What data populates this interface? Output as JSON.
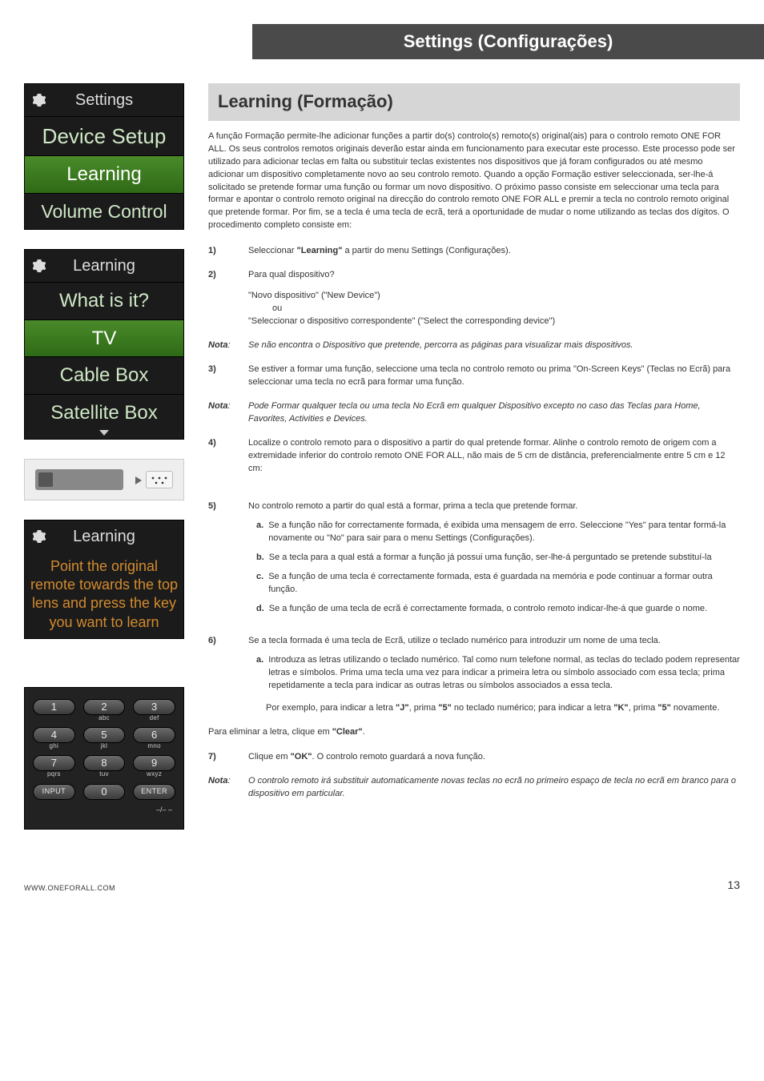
{
  "header": {
    "main_title": "Settings (Configurações)"
  },
  "left": {
    "panel1": {
      "gear": "gear",
      "title": "Settings",
      "rows": [
        "Device Setup",
        "Learning",
        "Volume Control"
      ]
    },
    "panel2": {
      "title": "Learning",
      "rows": [
        "What is it?",
        "TV",
        "Cable Box",
        "Satellite Box"
      ]
    },
    "panel3": {
      "title": "Learning",
      "instruction": "Point the original remote towards the top lens and press the key you want to learn"
    },
    "keypad": {
      "k1": "1",
      "k2": "2",
      "k3": "3",
      "l2": "abc",
      "l3": "def",
      "k4": "4",
      "k5": "5",
      "k6": "6",
      "l4": "ghi",
      "l5": "jkl",
      "l6": "mno",
      "k7": "7",
      "k8": "8",
      "k9": "9",
      "l7": "pqrs",
      "l8": "tuv",
      "l9": "wxyz",
      "kinput": "INPUT",
      "k0": "0",
      "kenter": "ENTER",
      "footnote": "–/– –"
    }
  },
  "right": {
    "section_title": "Learning (Formação)",
    "intro": "A função Formação permite-lhe adicionar funções a partir do(s) controlo(s) remoto(s) original(ais) para o controlo remoto ONE FOR ALL. Os seus controlos remotos originais deverão estar ainda em funcionamento para executar este processo. Este processo pode ser utilizado para adicionar teclas em falta ou substituir teclas existentes nos dispositivos que já foram configurados ou até mesmo adicionar um dispositivo completamente novo ao seu controlo remoto. Quando a opção Formação estiver seleccionada, ser-lhe-á solicitado se pretende formar uma função ou formar um novo dispositivo. O próximo passo consiste em seleccionar uma tecla para formar e apontar o controlo remoto original na direcção do controlo remoto ONE FOR ALL e premir a tecla no controlo remoto original que pretende formar. Por fim, se a tecla é uma tecla de ecrã, terá a oportunidade de mudar o nome utilizando as teclas dos dígitos. O procedimento completo consiste em:",
    "steps": {
      "s1_num": "1)",
      "s1_a": "Seleccionar ",
      "s1_b": "\"Learning\"",
      "s1_c": " a partir do menu Settings (Configurações).",
      "s2_num": "2)",
      "s2_a": "Para qual dispositivo?",
      "s2_b1": "\"Novo dispositivo\" (\"New Device\")",
      "s2_b2": "ou",
      "s2_b3": "\"Seleccionar o dispositivo correspondente\" (\"Select the corresponding device\")",
      "n1_num": "Nota",
      "n1_colon": ":",
      "n1_body": "Se não encontra o Dispositivo que pretende, percorra as páginas para visualizar mais dispositivos.",
      "s3_num": "3)",
      "s3_body": "Se estiver a formar uma função, seleccione uma tecla no controlo remoto ou prima \"On-Screen Keys\" (Teclas no Ecrã) para seleccionar uma tecla no ecrã para formar uma função.",
      "n2_num": "Nota",
      "n2_body": "Pode Formar qualquer tecla ou uma tecla No Ecrã em qualquer Dispositivo excepto no caso das Teclas para Home, Favorites, Activities e Devices.",
      "s4_num": "4)",
      "s4_body": "Localize o controlo remoto para o dispositivo a partir do qual pretende formar. Alinhe o controlo remoto de origem com a extremidade inferior do controlo remoto ONE FOR ALL, não mais de 5 cm de distância, preferencialmente entre 5 cm e 12 cm:",
      "s5_num": "5)",
      "s5_body": "No controlo remoto a partir do qual está a formar, prima a tecla que pretende formar.",
      "s5a_m": "a.",
      "s5a": "Se a função não for correctamente formada, é exibida uma mensagem de erro. Seleccione \"Yes\" para tentar formá-la novamente ou \"No\" para sair para o menu Settings (Configurações).",
      "s5b_m": "b.",
      "s5b": "Se a tecla para a qual está a formar a função já possui uma função, ser-lhe-á perguntado se pretende substituí-la",
      "s5c_m": "c.",
      "s5c": "Se a função de uma tecla é correctamente formada, esta é guardada na memória e pode continuar a formar outra função.",
      "s5d_m": "d.",
      "s5d": "Se a função de uma tecla de ecrã é correctamente formada, o controlo remoto indicar-lhe-á que guarde o nome.",
      "s6_num": "6)",
      "s6_body": "Se a tecla formada é uma tecla de Ecrã, utilize o teclado numérico para introduzir um nome de uma tecla.",
      "s6a_m": "a.",
      "s6a": "Introduza as letras utilizando o teclado numérico. Tal como num telefone normal, as teclas do teclado podem representar letras e símbolos. Prima uma tecla uma vez para indicar a primeira letra ou símbolo associado com essa tecla; prima repetidamente a tecla para indicar as outras letras ou símbolos associados a essa tecla.",
      "s6a2_a": "Por exemplo, para indicar a letra ",
      "s6a2_b": "\"J\"",
      "s6a2_c": ", prima ",
      "s6a2_d": "\"5\"",
      "s6a2_e": " no teclado numérico; para indicar a letra ",
      "s6a2_f": "\"K\"",
      "s6a2_g": ", prima ",
      "s6a2_h": "\"5\"",
      "s6a2_i": " novamente.",
      "clear_a": "Para eliminar a letra, clique em ",
      "clear_b": "\"Clear\"",
      "clear_c": ".",
      "s7_num": "7)",
      "s7_a": "Clique em ",
      "s7_b": "\"OK\"",
      "s7_c": ". O controlo remoto guardará a nova função.",
      "n3_num": "Nota",
      "n3_body": "O controlo remoto irá substituir automaticamente novas teclas no ecrã no primeiro espaço de tecla no ecrã em branco para o dispositivo em particular."
    }
  },
  "footer": {
    "url": "WWW.ONEFORALL.COM",
    "page": "13"
  }
}
